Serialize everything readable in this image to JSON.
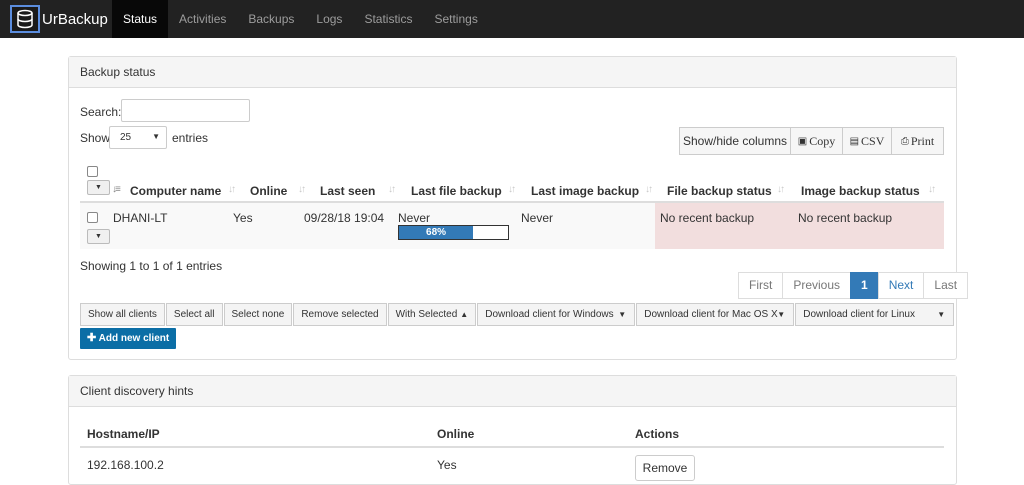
{
  "app": {
    "title": "UrBackup",
    "nav": [
      "Status",
      "Activities",
      "Backups",
      "Logs",
      "Statistics",
      "Settings"
    ],
    "active_nav": "Status"
  },
  "backup_status": {
    "heading": "Backup status",
    "search_label": "Search:",
    "search_value": "",
    "show_label": "Show",
    "entries_value": "25",
    "entries_label": "entries",
    "buttons": {
      "show_hide": "Show/hide columns",
      "copy": "Copy",
      "csv": "CSV",
      "print": "Print"
    },
    "columns": [
      "Computer name",
      "Online",
      "Last seen",
      "Last file backup",
      "Last image backup",
      "File backup status",
      "Image backup status"
    ],
    "rows": [
      {
        "computer_name": "DHANI-LT",
        "online": "Yes",
        "last_seen": "09/28/18 19:04",
        "last_file_backup": "Never",
        "progress_percent": 68,
        "progress_label": "68%",
        "last_image_backup": "Never",
        "file_backup_status": "No recent backup",
        "image_backup_status": "No recent backup"
      }
    ],
    "showing_text": "Showing 1 to 1 of 1 entries",
    "pagination": [
      "First",
      "Previous",
      "1",
      "Next",
      "Last"
    ],
    "actions": {
      "show_all_clients": "Show all clients",
      "select_all": "Select all",
      "select_none": "Select none",
      "remove_selected": "Remove selected",
      "with_selected": "With Selected",
      "dl_windows": "Download client for Windows",
      "dl_mac": "Download client for Mac OS X",
      "dl_linux": "Download client for Linux",
      "add_new_client": "Add new client"
    }
  },
  "discovery": {
    "heading": "Client discovery hints",
    "columns": [
      "Hostname/IP",
      "Online",
      "Actions"
    ],
    "row": {
      "hostname": "192.168.100.2",
      "online": "Yes",
      "action": "Remove"
    }
  },
  "colors": {
    "navbar": "#222222",
    "primary": "#337ab7",
    "warning_row": "#f2dede",
    "add_button": "#0b6ea6"
  }
}
